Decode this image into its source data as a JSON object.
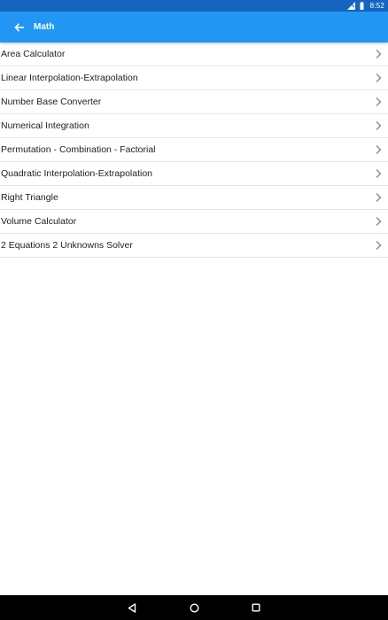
{
  "status_bar": {
    "time": "8:52",
    "icons": [
      "signal-icon",
      "battery-icon"
    ]
  },
  "app_bar": {
    "title": "Math",
    "back_icon": "arrow-left-icon"
  },
  "list": {
    "items": [
      {
        "label": "Area Calculator"
      },
      {
        "label": "Linear Interpolation-Extrapolation"
      },
      {
        "label": "Number Base Converter"
      },
      {
        "label": "Numerical Integration"
      },
      {
        "label": "Permutation - Combination - Factorial"
      },
      {
        "label": "Quadratic Interpolation-Extrapolation"
      },
      {
        "label": "Right Triangle"
      },
      {
        "label": "Volume Calculator"
      },
      {
        "label": "2 Equations 2 Unknowns Solver"
      }
    ],
    "item_icon": "chevron-right-icon"
  },
  "nav_bar": {
    "buttons": [
      "back-triangle-icon",
      "home-circle-icon",
      "recents-square-icon"
    ]
  },
  "colors": {
    "status_bar": "#1565c0",
    "app_bar": "#2196f3",
    "text": "#212121",
    "chevron": "#8a8a8a",
    "divider": "#e6e6e6",
    "nav_bar": "#000000"
  }
}
